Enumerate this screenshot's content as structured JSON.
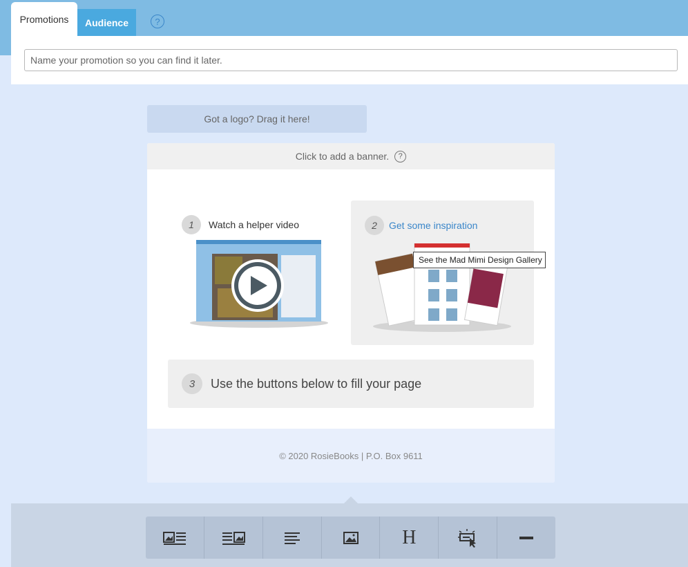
{
  "tabs": {
    "promotions": "Promotions",
    "audience": "Audience",
    "help": "?"
  },
  "name_input": {
    "placeholder": "Name your promotion so you can find it later."
  },
  "logo_drop": "Got a logo? Drag it here!",
  "banner": {
    "label": "Click to add a banner.",
    "help": "?"
  },
  "steps": {
    "one": {
      "num": "1",
      "label": "Watch a helper video"
    },
    "two": {
      "num": "2",
      "label": "Get some inspiration"
    },
    "three": {
      "num": "3",
      "label": "Use the buttons below to fill your page"
    }
  },
  "tooltip": "See the Mad Mimi Design Gallery",
  "footer": "© 2020 RosieBooks | P.O. Box 9611",
  "toolbar": {
    "items": [
      {
        "icon": "image-left-text-icon"
      },
      {
        "icon": "image-right-text-icon"
      },
      {
        "icon": "text-block-icon"
      },
      {
        "icon": "image-icon"
      },
      {
        "icon": "heading-icon",
        "glyph": "H"
      },
      {
        "icon": "button-icon"
      },
      {
        "icon": "divider-icon"
      }
    ]
  },
  "colors": {
    "topbar": "#7fbbe3",
    "audience_tab": "#4aa9df",
    "link": "#3a86c9",
    "canvas": "#dde9fb"
  }
}
